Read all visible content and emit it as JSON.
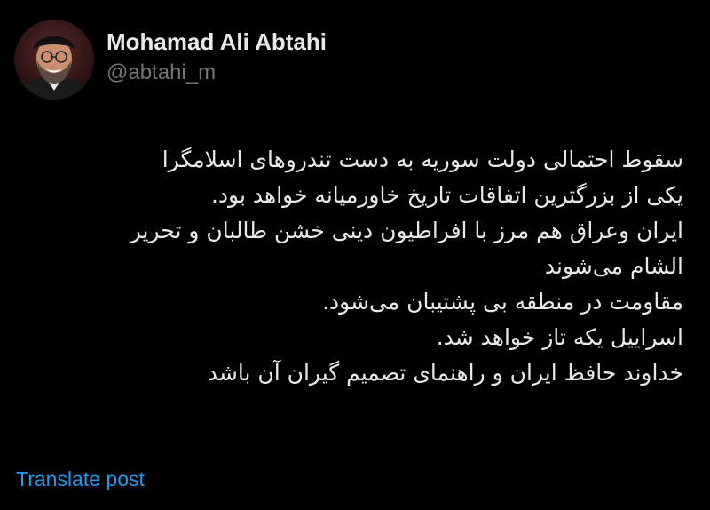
{
  "author": {
    "display_name": "Mohamad Ali Abtahi",
    "handle": "@abtahi_m",
    "avatar_icon": "profile-photo"
  },
  "post": {
    "lines": [
      "سقوط احتمالی دولت سوریه به دست تندروهای اسلامگرا",
      "یکی از بزرگترین اتفاقات تاریخ خاورمیانه خواهد بود.",
      "ایران وعراق هم مرز با افراطیون دینی خشن طالبان و تحریر",
      "الشام می‌شوند",
      "مقاومت در منطقه بی پشتیبان می‌شود.",
      "اسراییل یکه تاز خواهد شد.",
      "خداوند حافظ ایران و راهنمای تصمیم گیران آن  باشد"
    ],
    "translate_label": "Translate post"
  },
  "colors": {
    "background": "#000000",
    "primary_text": "#e7e9ea",
    "secondary_text": "#71767b",
    "link": "#1d9bf0"
  }
}
